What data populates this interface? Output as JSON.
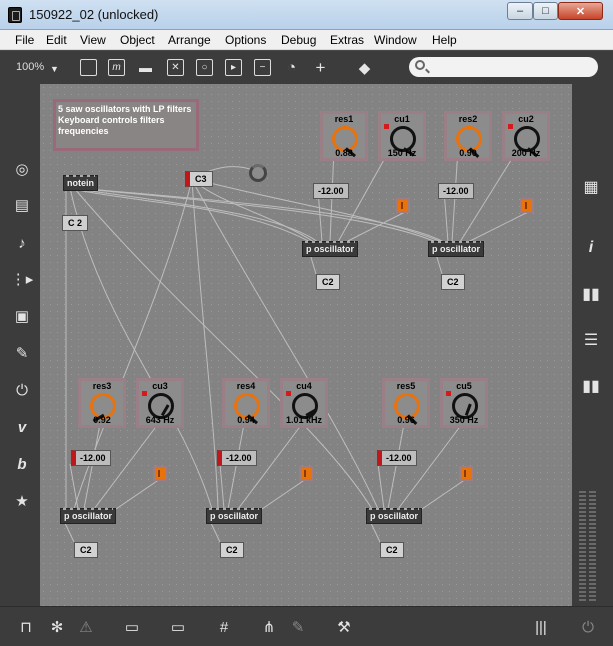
{
  "window": {
    "title": "150922_02 (unlocked)",
    "minimize_glyph": "–",
    "maximize_glyph": "□",
    "close_glyph": "✕"
  },
  "menu": [
    "File",
    "Edit",
    "View",
    "Object",
    "Arrange",
    "Options",
    "Debug",
    "Extras",
    "Window",
    "Help"
  ],
  "toolbar": {
    "zoom": "100%",
    "icons": [
      "presentation-icon",
      "message-icon",
      "comment-icon",
      "toggle-box-icon",
      "button-icon",
      "play-icon",
      "slider-icon",
      "dial-icon",
      "plus-icon",
      "paint-bucket-icon"
    ],
    "search_placeholder": ""
  },
  "left_sidebar_icons": [
    "object-explorer-icon",
    "keyboard-icon",
    "music-note-icon",
    "midi-flow-icon",
    "image-icon",
    "paperclip-icon",
    "plug-icon",
    "vimeo-icon",
    "bitmap-b-icon",
    "star-icon"
  ],
  "right_sidebar_icons": [
    "grid-icon",
    "info-icon",
    "book-icon",
    "list-icon",
    "reference-icon"
  ],
  "bottom_bar_icons": [
    "lock-icon",
    "snowflake-icon",
    "warning-icon",
    "windows-icon",
    "presentation-icon",
    "grid-icon",
    "hierarchy-icon",
    "pin-icon",
    "wrench-icon",
    "mixer-icon",
    "power-icon"
  ],
  "patch": {
    "comment": "5 saw oscillators with LP filters\nKeyboard controls filters frequencies",
    "notein": "notein",
    "note_c2_top": "C 2",
    "c3": "C3",
    "dials": {
      "res1": {
        "label": "res1",
        "value": "0.88"
      },
      "cu1": {
        "label": "cu1",
        "value": "150 Hz"
      },
      "res2": {
        "label": "res2",
        "value": "0.90"
      },
      "cu2": {
        "label": "cu2",
        "value": "200 Hz"
      },
      "res3": {
        "label": "res3",
        "value": "0.92"
      },
      "cu3": {
        "label": "cu3",
        "value": "643 Hz"
      },
      "res4": {
        "label": "res4",
        "value": "0.94"
      },
      "cu4": {
        "label": "cu4",
        "value": "1.01 kHz"
      },
      "res5": {
        "label": "res5",
        "value": "0.96"
      },
      "cu5": {
        "label": "cu5",
        "value": "350 Hz"
      }
    },
    "numbers": {
      "n1": "-12.00",
      "n2": "-12.00",
      "n3": "-12.00",
      "n4": "-12.00",
      "n5": "-12.00"
    },
    "oscillators": {
      "o1": "p oscillator",
      "o2": "p oscillator",
      "o3": "p oscillator",
      "o4": "p oscillator",
      "o5": "p oscillator"
    },
    "note_msgs": {
      "m1": "C2",
      "m2": "C2",
      "m3": "C2",
      "m4": "C2",
      "m5": "C2"
    }
  }
}
